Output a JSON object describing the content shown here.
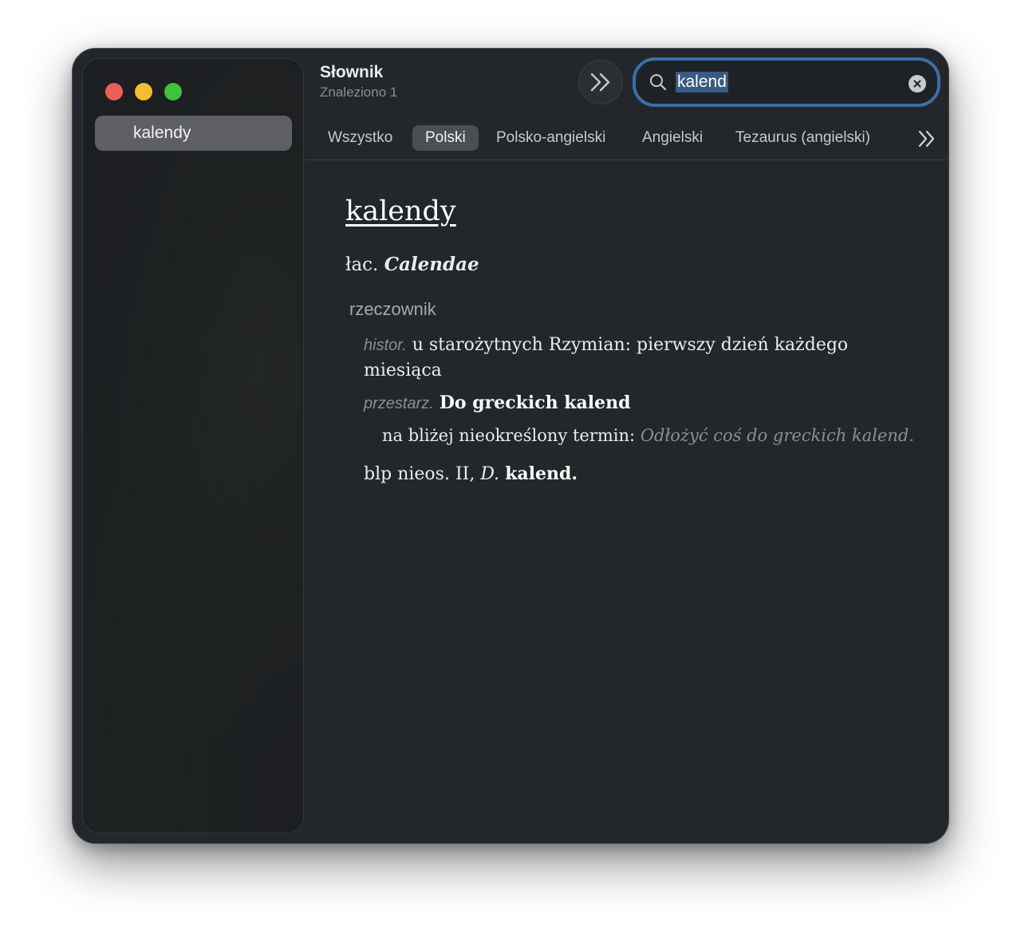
{
  "app": {
    "title": "Słownik",
    "subtitle": "Znaleziono 1"
  },
  "search": {
    "value": "kalend"
  },
  "sidebar": {
    "items": [
      {
        "label": "kalendy",
        "selected": true
      }
    ]
  },
  "tabs": [
    {
      "label": "Wszystko",
      "active": false
    },
    {
      "label": "Polski",
      "active": true
    },
    {
      "label": "Polsko-angielski",
      "active": false
    },
    {
      "label": "Angielski",
      "active": false
    },
    {
      "label": "Tezaurus (angielski)",
      "active": false
    }
  ],
  "entry": {
    "headword": "kalendy",
    "etym_prefix": "łac.",
    "etym_word": "Calendae",
    "part_of_speech": "rzeczownik",
    "definitions": [
      {
        "label": "histor.",
        "text": "u starożytnych Rzymian: pierwszy dzień każdego miesiąca"
      },
      {
        "label": "przestarz.",
        "phrase": "Do greckich kalend",
        "sub": {
          "text": "na bliżej nieokreślony termin:",
          "example": "Odłożyć coś do greckich kalend."
        }
      }
    ],
    "grammar": {
      "text": "blp nieos. II,",
      "case": "D.",
      "form": "kalend."
    }
  },
  "colors": {
    "accent": "#3b6fa8",
    "close": "#ec5f58",
    "minimize": "#f2bd2f",
    "maximize": "#3fc23d",
    "window_bg": "#23262b"
  },
  "icons": [
    "close-window-icon",
    "minimize-window-icon",
    "maximize-window-icon",
    "double-chevron-right-icon",
    "search-icon",
    "clear-icon"
  ]
}
